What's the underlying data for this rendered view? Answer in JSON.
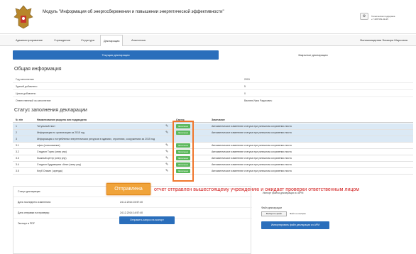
{
  "header": {
    "title": "Модуль \"Информация об энергосбережении и повышении энергетической эффективности\"",
    "gear_label": "⚙",
    "support_line1": "Техническая поддержка",
    "support_line2": "+7 495 553-49-45"
  },
  "nav": {
    "items": [
      {
        "label": "Администрирование"
      },
      {
        "label": "Учреждения"
      },
      {
        "label": "Структура"
      },
      {
        "label": "Декларация"
      },
      {
        "label": "Аналитика"
      }
    ],
    "user": "Валиахмадеева Эльвира Марсовна"
  },
  "tabs": {
    "current": "Текущая декларация",
    "closed": "Закрытые декларации"
  },
  "general": {
    "title": "Общая информация",
    "rows": [
      {
        "label": "Год заполнения",
        "value": "2015"
      },
      {
        "label": "Зданий добавлено",
        "value": "5"
      },
      {
        "label": "Цехов добавлено",
        "value": "0"
      },
      {
        "label": "Ответственный за заполнение",
        "value": "Валиев Ирик Радикович"
      }
    ]
  },
  "status": {
    "title": "Статус заполнения декларации",
    "headers": [
      "№ п/п",
      "Наименование раздела или подраздела",
      "Статус",
      "Замечание"
    ],
    "rows": [
      {
        "num": "1",
        "name": "Титульный лист",
        "badge": "Заполнено",
        "note": "Автоматическое изменение статуса при успешном сохранении листа",
        "highlight": true,
        "edit": true
      },
      {
        "num": "2",
        "name": "Информация по организации за 2015 год",
        "badge": "Заполнено",
        "note": "Автоматическое изменение статуса при успешном сохранении листа",
        "highlight": true,
        "edit": true
      },
      {
        "num": "3",
        "name": "Информация о потреблении энергетических ресурсов в зданиях, строениях, сооружениях за 2015 год",
        "badge": "",
        "note": "",
        "highlight": true,
        "edit": false
      },
      {
        "num": "3.1",
        "name": "офис (пользование)",
        "badge": "Заполнено",
        "note": "Автоматическое изменение статуса при успешном сохранении листа",
        "highlight": false,
        "edit": true
      },
      {
        "num": "3.2",
        "name": "Стадион Торпс (опер упр)",
        "badge": "Заполнено",
        "note": "Автоматическое изменение статуса при успешном сохранении листа",
        "highlight": false,
        "edit": true
      },
      {
        "num": "3.3",
        "name": "Лыжный центр (опер упр)",
        "badge": "Заполнено",
        "note": "Автоматическое изменение статуса при успешном сохранении листа",
        "highlight": false,
        "edit": true
      },
      {
        "num": "3.4",
        "name": "Стадион Кудрявцева г.Анкп (опер упр)",
        "badge": "Заполнено",
        "note": "Автоматическое изменение статуса при успешном сохранении листа",
        "highlight": false,
        "edit": true
      },
      {
        "num": "3.5",
        "name": "Клуб Олимп ( аренда)",
        "badge": "Заполнено",
        "note": "Автоматическое изменение статуса при успешном сохранении листа",
        "highlight": false,
        "edit": true
      }
    ]
  },
  "declaration": {
    "status_label": "Статус декларации:",
    "status_value": "Отправлена",
    "changed_label": "Дата последнего изменения:",
    "changed_value": "24.12.2014 15:57:40",
    "sent_label": "Дата отправки на проверку:",
    "sent_value": "24.12.2014 14:57:40",
    "export_label": "Экспорт в PDF",
    "send_button": "Отправить запрос на экспорт",
    "annotation": "отчет отправлен вышестоящему учреждению и ожидает проверки ответственным лицом"
  },
  "import": {
    "title": "Импорт файла декларации из АРМ",
    "file_label": "Файл декларации",
    "file_button": "Выберите файл",
    "file_text": "Файл не выбран",
    "import_button": "Импортировать файл декларации из АРМ"
  },
  "colors": {
    "accent": "#2a6ebb",
    "success": "#5cb85c",
    "highlight_row": "#dbe9f5",
    "annotation": "#d21f1f",
    "status_badge": "#f0a33a"
  }
}
